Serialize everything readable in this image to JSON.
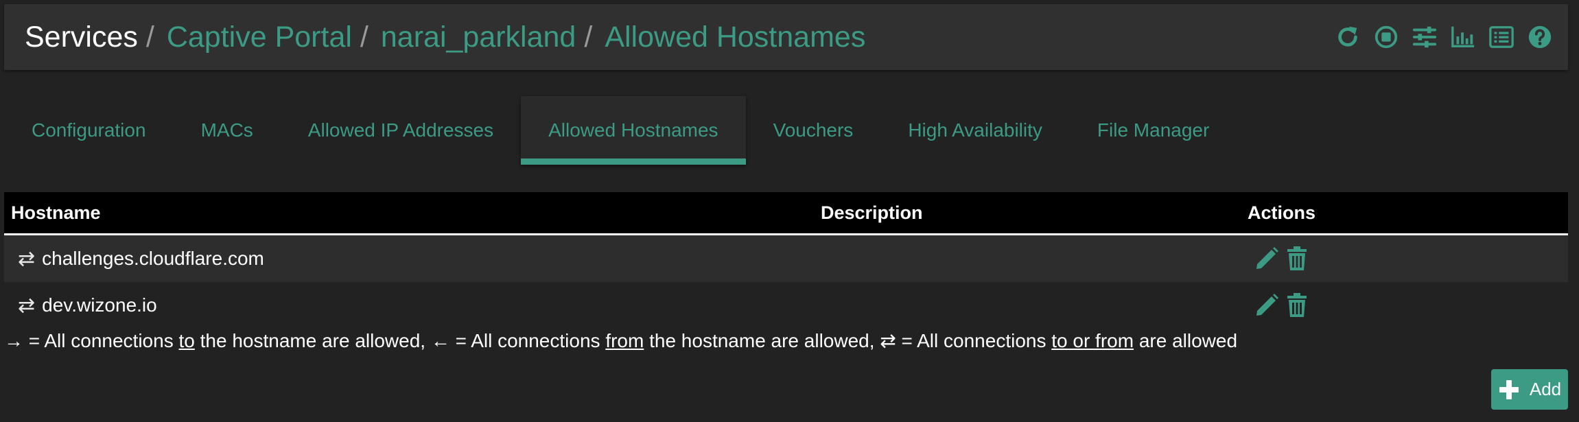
{
  "breadcrumb": {
    "root": "Services",
    "separator": "/",
    "items": [
      "Captive Portal",
      "narai_parkland",
      "Allowed Hostnames"
    ]
  },
  "header_icons": [
    "refresh-icon",
    "stop-icon",
    "settings-sliders-icon",
    "chart-icon",
    "list-icon",
    "help-icon"
  ],
  "tabs": [
    {
      "label": "Configuration",
      "active": false
    },
    {
      "label": "MACs",
      "active": false
    },
    {
      "label": "Allowed IP Addresses",
      "active": false
    },
    {
      "label": "Allowed Hostnames",
      "active": true
    },
    {
      "label": "Vouchers",
      "active": false
    },
    {
      "label": "High Availability",
      "active": false
    },
    {
      "label": "File Manager",
      "active": false
    }
  ],
  "table": {
    "columns": {
      "hostname": "Hostname",
      "description": "Description",
      "actions": "Actions"
    },
    "rows": [
      {
        "direction_glyph": "⇄",
        "hostname": "challenges.cloudflare.com",
        "description": ""
      },
      {
        "direction_glyph": "⇄",
        "hostname": "dev.wizone.io",
        "description": ""
      }
    ]
  },
  "legend": {
    "to_glyph": "→",
    "to_prefix": " = All connections ",
    "to_word": "to",
    "to_suffix": " the hostname are allowed, ",
    "from_glyph": "←",
    "from_prefix": " = All connections ",
    "from_word": "from",
    "from_suffix": " the hostname are allowed, ",
    "both_glyph": "⇄",
    "both_prefix": " = All connections ",
    "both_word": "to or from",
    "both_suffix": " are allowed"
  },
  "add_button": {
    "label": "Add"
  },
  "colors": {
    "accent": "#3c9b85",
    "background": "#222222",
    "header_bg": "#303030",
    "table_header_bg": "#000000"
  }
}
